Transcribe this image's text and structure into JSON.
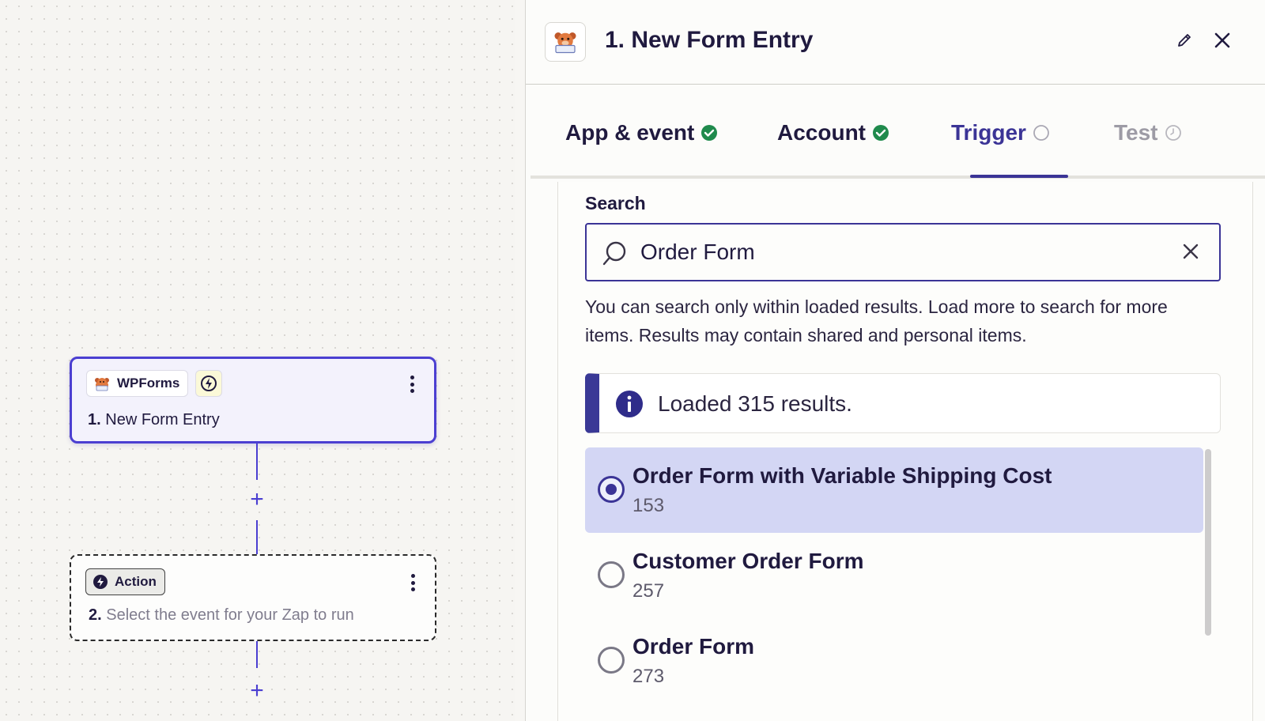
{
  "canvas": {
    "trigger_step": {
      "app_name": "WPForms",
      "number": "1.",
      "title": "New Form Entry",
      "app_icon": "wpforms-bear-icon",
      "type_icon": "lightning-bolt-icon"
    },
    "action_step": {
      "chip_label": "Action",
      "number": "2.",
      "placeholder": "Select the event for your Zap to run",
      "type_icon": "lightning-bolt-icon"
    },
    "add_step_symbol": "+"
  },
  "panel": {
    "title": "1. New Form Entry",
    "icons": {
      "edit": "pencil-icon",
      "close": "close-icon"
    },
    "tabs": [
      {
        "label": "App & event",
        "status": "complete"
      },
      {
        "label": "Account",
        "status": "complete"
      },
      {
        "label": "Trigger",
        "status": "active"
      },
      {
        "label": "Test",
        "status": "disabled"
      }
    ],
    "search": {
      "label": "Search",
      "value": "Order Form",
      "helper": "You can search only within loaded results. Load more to search for more items. Results may contain shared and personal items."
    },
    "info_banner": {
      "text": "Loaded 315 results."
    },
    "options": [
      {
        "title": "Order Form with Variable Shipping Cost",
        "id": "153",
        "selected": true
      },
      {
        "title": "Customer Order Form",
        "id": "257",
        "selected": false
      },
      {
        "title": "Order Form",
        "id": "273",
        "selected": false
      }
    ]
  },
  "colors": {
    "accent": "#3b3496",
    "canvas_accent": "#4b3fd1",
    "success": "#1f8a4c",
    "selected_bg": "#d3d6f4"
  }
}
